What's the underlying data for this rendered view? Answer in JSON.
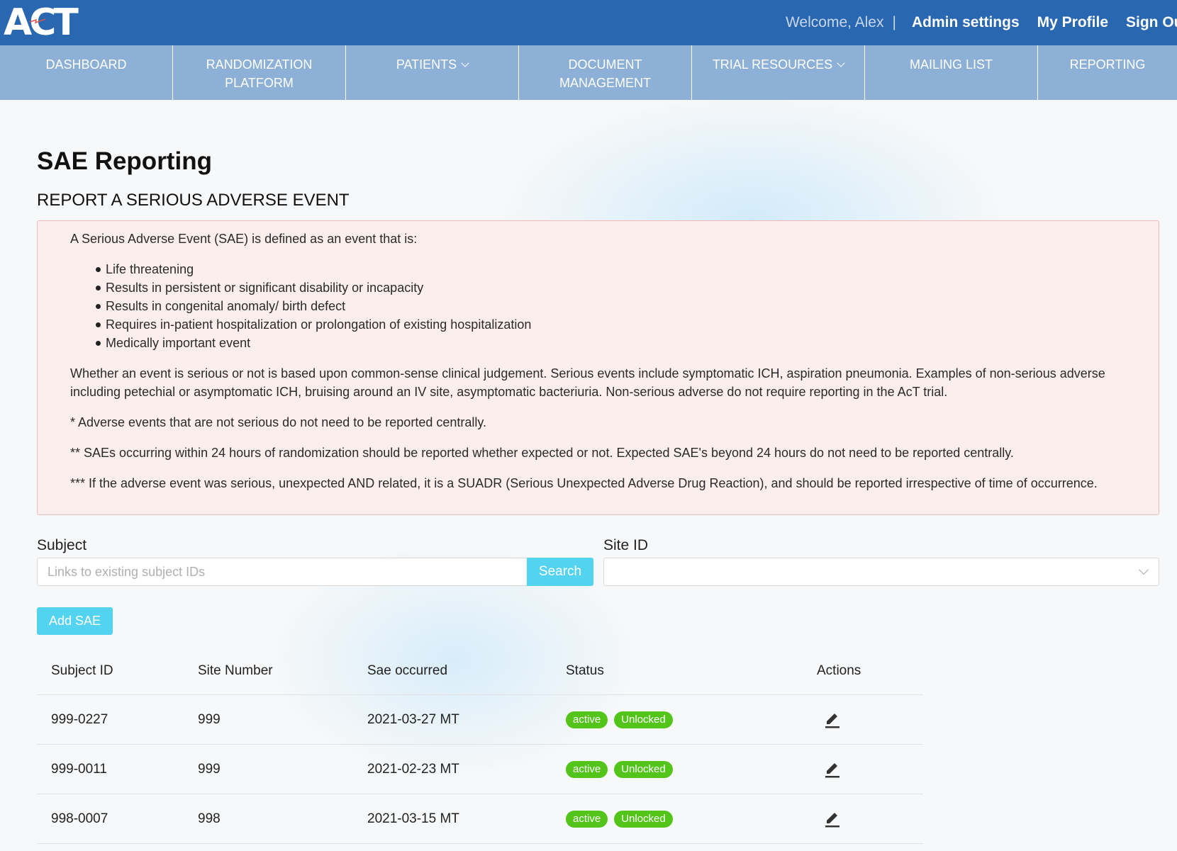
{
  "header": {
    "logo_text": "ACT",
    "welcome": "Welcome, Alex",
    "separator": "|",
    "links": [
      "Admin settings",
      "My Profile",
      "Sign Out"
    ]
  },
  "nav": {
    "items": [
      {
        "label": "DASHBOARD",
        "line2": "",
        "dropdown": false
      },
      {
        "label": "RANDOMIZATION",
        "line2": "PLATFORM",
        "dropdown": false
      },
      {
        "label": "PATIENTS",
        "line2": "",
        "dropdown": true
      },
      {
        "label": "DOCUMENT",
        "line2": "MANAGEMENT",
        "dropdown": false
      },
      {
        "label": "TRIAL RESOURCES",
        "line2": "",
        "dropdown": true
      },
      {
        "label": "MAILING LIST",
        "line2": "",
        "dropdown": false
      },
      {
        "label": "REPORTING",
        "line2": "",
        "dropdown": false
      }
    ]
  },
  "page": {
    "title": "SAE Reporting",
    "section_title": "REPORT A SERIOUS ADVERSE EVENT"
  },
  "alert": {
    "intro": "A Serious Adverse Event (SAE) is defined as an event that is:",
    "bullets": [
      "Life threatening",
      "Results in persistent or significant disability or incapacity",
      "Results in congenital anomaly/ birth defect",
      "Requires in-patient hospitalization or prolongation of existing hospitalization",
      "Medically important event"
    ],
    "para1": "Whether an event is serious or not is based upon common-sense clinical judgement. Serious events include symptomatic ICH, aspiration pneumonia. Examples of non-serious adverse including petechial or asymptomatic ICH, bruising around an IV site, asymptomatic bacteriuria. Non-serious adverse do not require reporting in the AcT trial.",
    "note1": "* Adverse events that are not serious do not need to be reported centrally.",
    "note2": "** SAEs occurring within 24 hours of randomization should be reported whether expected or not. Expected SAE's beyond 24 hours do not need to be reported centrally.",
    "note3": "*** If the adverse event was serious, unexpected AND related, it is a SUADR (Serious Unexpected Adverse Drug Reaction), and should be reported irrespective of time of occurrence."
  },
  "form": {
    "subject_label": "Subject",
    "subject_placeholder": "Links to existing subject IDs",
    "subject_value": "",
    "search_label": "Search",
    "site_label": "Site ID",
    "site_value": "",
    "add_label": "Add SAE"
  },
  "table": {
    "headers": [
      "Subject ID",
      "Site Number",
      "Sae occurred",
      "Status",
      "Actions"
    ],
    "rows": [
      {
        "subject_id": "999-0227",
        "site": "999",
        "occurred": "2021-03-27 MT",
        "status": "active",
        "lock": "Unlocked"
      },
      {
        "subject_id": "999-0011",
        "site": "999",
        "occurred": "2021-02-23 MT",
        "status": "active",
        "lock": "Unlocked"
      },
      {
        "subject_id": "998-0007",
        "site": "998",
        "occurred": "2021-03-15 MT",
        "status": "active",
        "lock": "Unlocked"
      }
    ]
  },
  "colors": {
    "header_bg": "#2a67b1",
    "nav_bg": "#8db0d7",
    "button": "#53d3ef",
    "badge": "#52c41a",
    "alert_bg": "#fdeeee",
    "alert_border": "#f2b9b9"
  },
  "icons": {
    "nav_dropdown": "chevron-down-icon",
    "select": "chevron-down-icon",
    "edit": "pencil-icon"
  }
}
